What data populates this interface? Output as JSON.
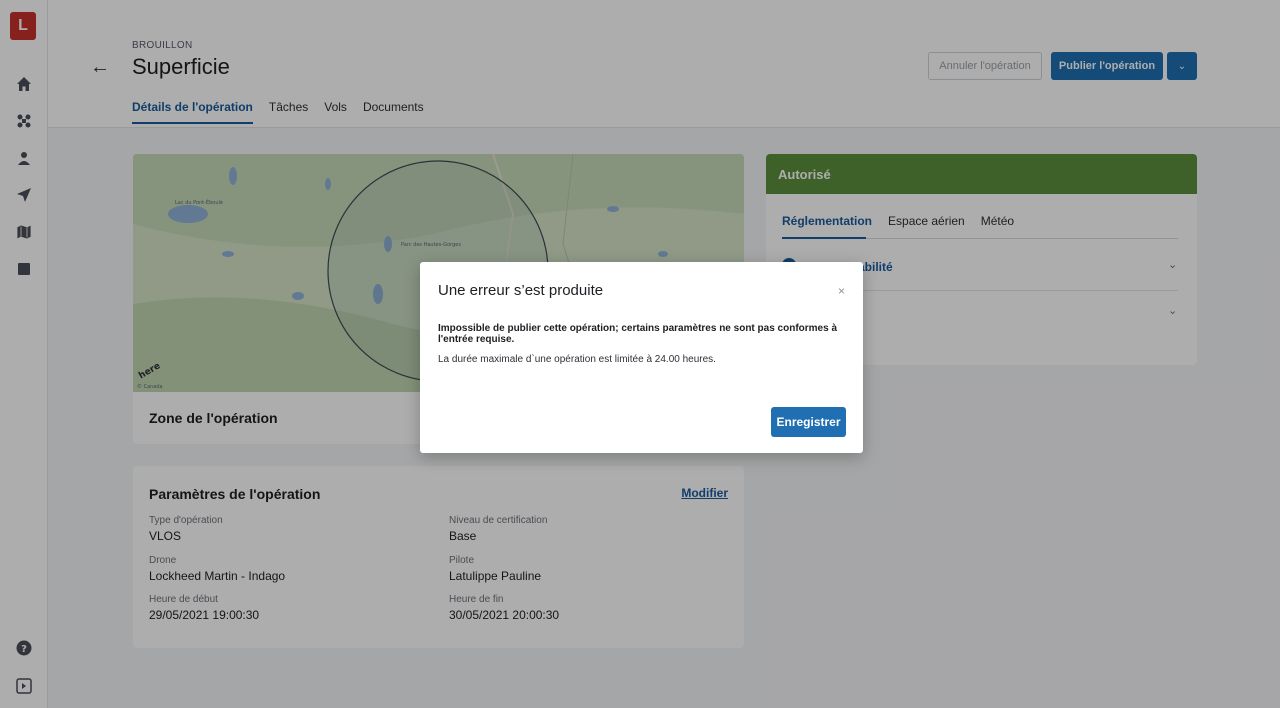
{
  "sidebar": {
    "logo": "L",
    "icons": [
      "home-icon",
      "drone-icon",
      "person-icon",
      "send-icon",
      "map-icon",
      "book-icon",
      "help-icon",
      "collapse-icon"
    ]
  },
  "header": {
    "status": "BROUILLON",
    "title": "Superficie",
    "tabs": [
      "Détails de l'opération",
      "Tâches",
      "Vols",
      "Documents"
    ],
    "cancel_label": "Annuler l'opération",
    "publish_label": "Publier l'opération"
  },
  "map": {
    "labels": [
      "Lac du Pont-Éboulé",
      "Parc des Hautes-Gorges-de-la-Rivière-Malbaie",
      "here",
      "© Canada"
    ]
  },
  "zone": {
    "label": "Zone de l'opération"
  },
  "params": {
    "title": "Paramètres de l'opération",
    "edit_label": "Modifier",
    "fields": {
      "type_label": "Type d'opération",
      "type_value": "VLOS",
      "cert_label": "Niveau de certification",
      "cert_value": "Base",
      "drone_label": "Drone",
      "drone_value": "Lockheed Martin - Indago",
      "pilot_label": "Pilote",
      "pilot_value": "Latulippe Pauline",
      "start_label": "Heure de début",
      "start_value": "29/05/2021 19:00:30",
      "end_label": "Heure de fin",
      "end_value": "30/05/2021 20:00:30"
    }
  },
  "auth": {
    "header": "Autorisé",
    "tabs": [
      "Réglementation",
      "Espace aérien",
      "Météo"
    ],
    "accordion_1": "n-responsabilité"
  },
  "modal": {
    "title": "Une erreur s’est produite",
    "close": "×",
    "bold_text": "Impossible de publier cette opération; certains paramètres ne sont pas conformes à l'entrée requise.",
    "text": "La durée maximale d`une opération est limitée à 24.00 heures.",
    "save_label": "Enregistrer"
  },
  "colors": {
    "accent": "#1f6fb2",
    "success": "#5a8f3c",
    "logo": "#c8322b"
  }
}
